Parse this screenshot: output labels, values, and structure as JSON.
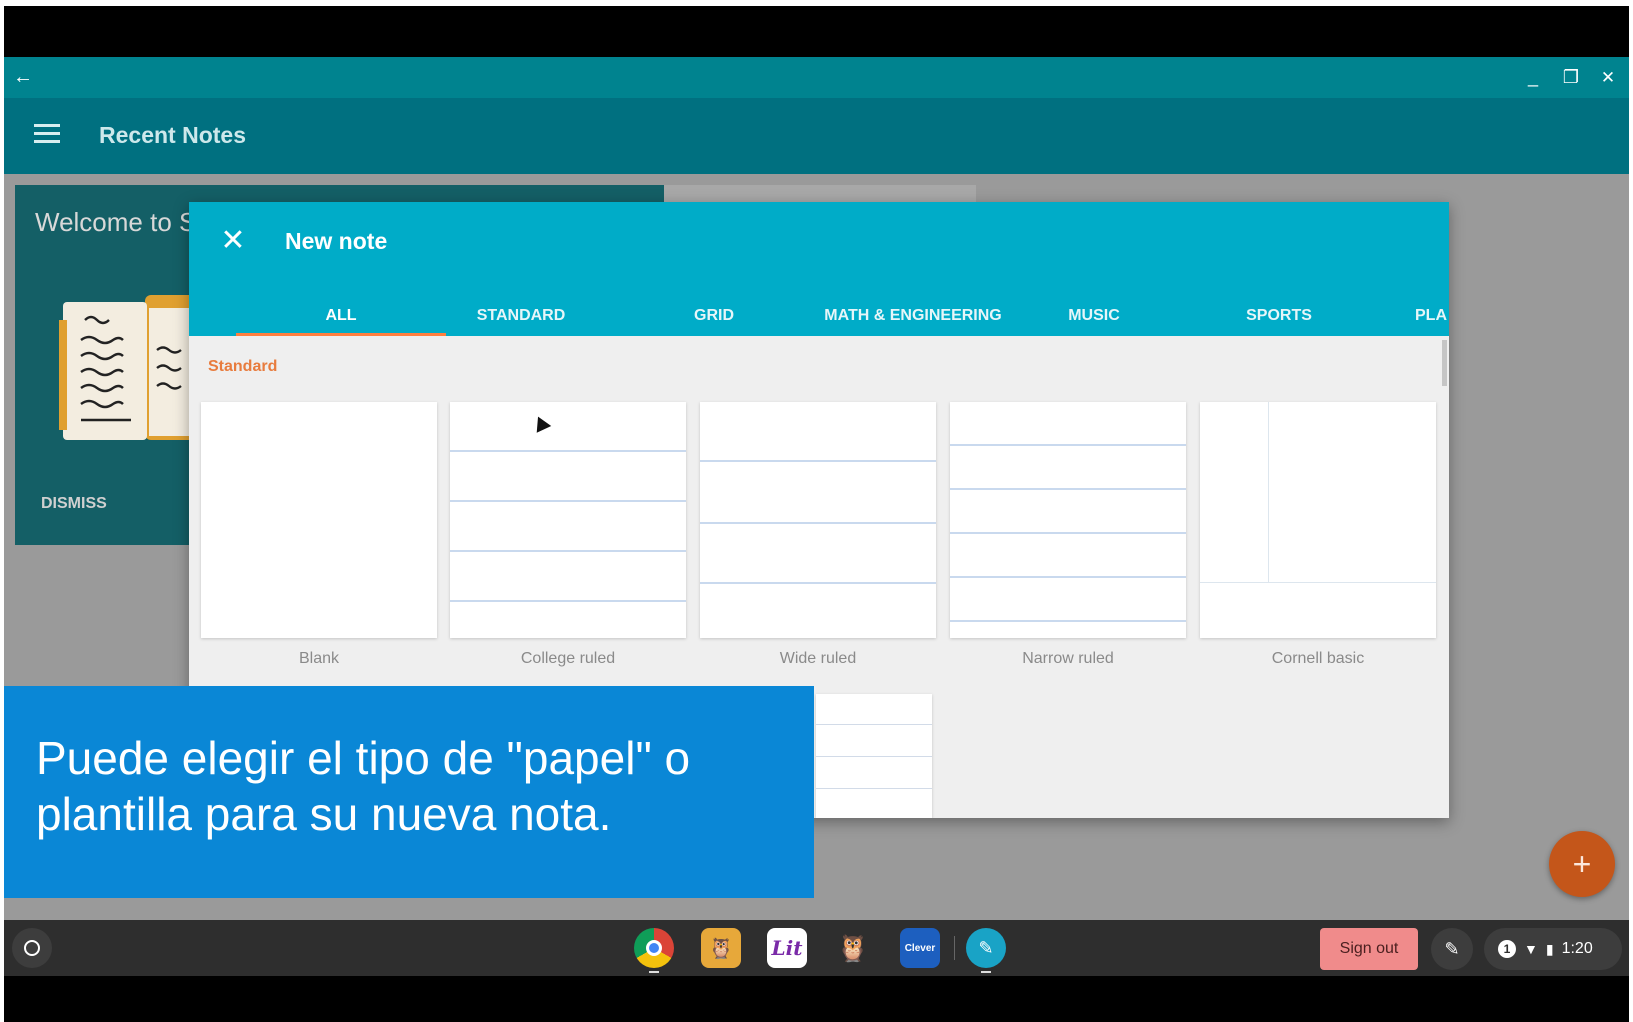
{
  "window": {
    "back_icon": "arrow-left-icon",
    "minimize_glyph": "_",
    "restore_glyph": "❐",
    "close_glyph": "✕"
  },
  "toolbar": {
    "menu_icon": "hamburger-icon",
    "title": "Recent Notes"
  },
  "welcome_card": {
    "title": "Welcome to S",
    "dismiss_label": "DISMISS"
  },
  "dialog": {
    "close_glyph": "✕",
    "title": "New note",
    "tabs": [
      {
        "label": "ALL",
        "active": true
      },
      {
        "label": "STANDARD",
        "active": false
      },
      {
        "label": "GRID",
        "active": false
      },
      {
        "label": "MATH & ENGINEERING",
        "active": false
      },
      {
        "label": "MUSIC",
        "active": false
      },
      {
        "label": "SPORTS",
        "active": false
      },
      {
        "label": "PLA",
        "active": false
      }
    ],
    "section_label": "Standard",
    "templates": [
      {
        "label": "Blank"
      },
      {
        "label": "College ruled"
      },
      {
        "label": "Wide ruled"
      },
      {
        "label": "Narrow ruled"
      },
      {
        "label": "Cornell basic"
      }
    ]
  },
  "caption": {
    "text": "Puede elegir el tipo de \"papel\" o plantilla para su nueva nota."
  },
  "fab": {
    "glyph": "+"
  },
  "shelf": {
    "apps": [
      "chrome-icon",
      "owl-icon",
      "lit-icon",
      "duolingo-icon",
      "clever-icon",
      "squid-icon"
    ],
    "lit_label": "Lit",
    "clever_label": "Clever",
    "sign_out": "Sign out",
    "notification_count": "1",
    "time": "1:20"
  },
  "colors": {
    "title_bar": "#00838f",
    "toolbar": "#007080",
    "dialog_header": "#00acc8",
    "tab_indicator": "#ff7f3f",
    "section_label": "#e87c3e",
    "caption_bg": "#0a87d6",
    "fab": "#c4561a",
    "sign_out_bg": "#f08b8b"
  }
}
